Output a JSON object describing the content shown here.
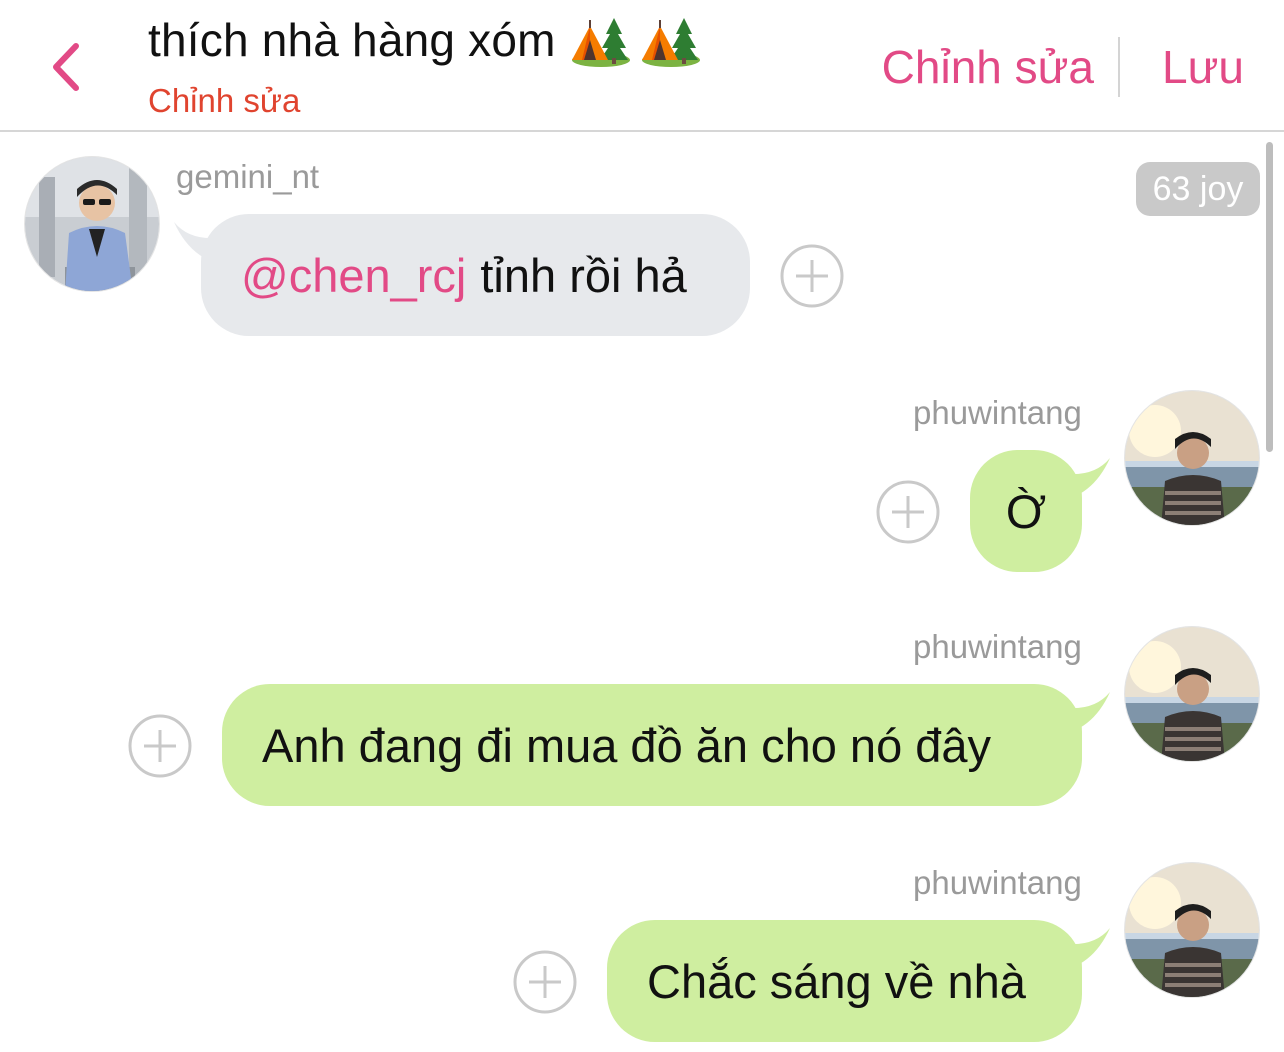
{
  "header": {
    "title": "thích nhà hàng xóm",
    "title_icons": [
      "tent-tree-icon",
      "tent-tree-icon"
    ],
    "subtitle": "Chỉnh sửa",
    "edit_label": "Chỉnh sửa",
    "save_label": "Lưu",
    "back_icon": "chevron-left-icon"
  },
  "colors": {
    "accent": "#e24a86",
    "subtitle": "#e0442f",
    "incoming_bubble": "#e7e9ec",
    "outgoing_bubble": "#cfeea0",
    "username": "#9a9a9a"
  },
  "messages": [
    {
      "sender": "gemini_nt",
      "direction": "incoming",
      "mention": "@chen_rcj",
      "text": "tỉnh rồi hả",
      "reaction_icon": "add-reaction-icon"
    },
    {
      "sender": "phuwintang",
      "direction": "outgoing",
      "text": "Ờ",
      "reaction_icon": "add-reaction-icon"
    },
    {
      "sender": "phuwintang",
      "direction": "outgoing",
      "text": "Anh đang đi mua đồ ăn cho nó đây",
      "reaction_icon": "add-reaction-icon"
    },
    {
      "sender": "phuwintang",
      "direction": "outgoing",
      "text": "Chắc sáng về nhà",
      "reaction_icon": "add-reaction-icon"
    }
  ],
  "badge": {
    "joy": "63 joy"
  }
}
